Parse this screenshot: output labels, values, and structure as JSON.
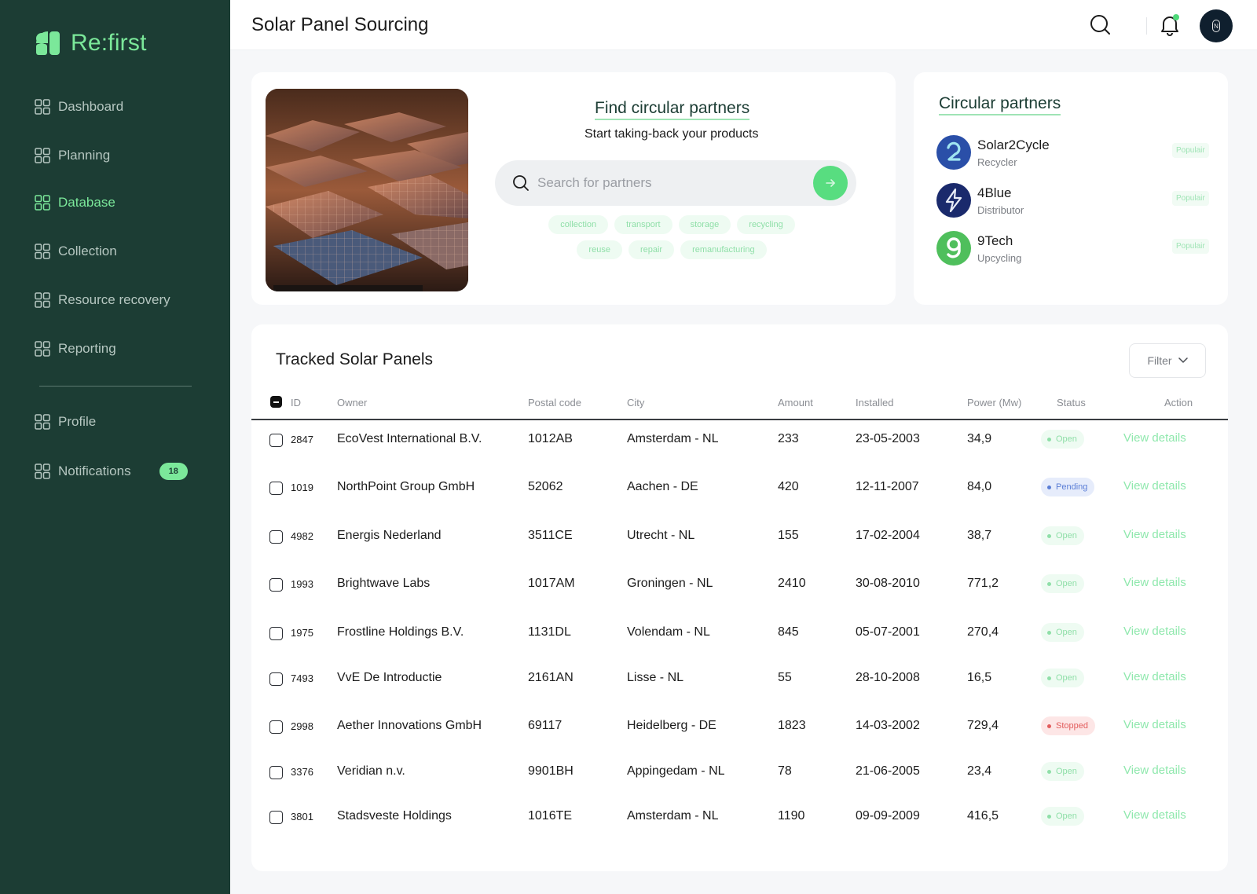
{
  "brand": {
    "name": "Re:first"
  },
  "sidebar": {
    "items": [
      {
        "label": "Dashboard",
        "active": false
      },
      {
        "label": "Planning",
        "active": false
      },
      {
        "label": "Database",
        "active": true
      },
      {
        "label": "Collection",
        "active": false
      },
      {
        "label": "Resource recovery",
        "active": false
      },
      {
        "label": "Reporting",
        "active": false
      }
    ],
    "bottom_items": [
      {
        "label": "Profile"
      },
      {
        "label": "Notifications",
        "badge": "18"
      }
    ]
  },
  "header": {
    "title": "Solar Panel Sourcing"
  },
  "find": {
    "title": "Find circular partners",
    "subtitle": "Start taking-back your products",
    "search_placeholder": "Search for partners",
    "chips_row1": [
      "collection",
      "transport",
      "storage",
      "recycling"
    ],
    "chips_row2": [
      "reuse",
      "repair",
      "remanufacturing"
    ]
  },
  "partners": {
    "title": "Circular partners",
    "items": [
      {
        "name": "Solar2Cycle",
        "role": "Recycler",
        "tag": "Populair",
        "icon": "cycle-2-icon",
        "color": "#2a4fa8"
      },
      {
        "name": "4Blue",
        "role": "Distributor",
        "tag": "Populair",
        "icon": "bolt-icon",
        "color": "#1a2a6c"
      },
      {
        "name": "9Tech",
        "role": "Upcycling",
        "tag": "Populair",
        "icon": "nine-icon",
        "color": "#4fbf5c"
      }
    ]
  },
  "table": {
    "title": "Tracked Solar Panels",
    "filter_label": "Filter",
    "columns": [
      "ID",
      "Owner",
      "Postal code",
      "City",
      "Amount",
      "Installed",
      "Power (Mw)",
      "Status",
      "Action"
    ],
    "action_label": "View details",
    "rows": [
      {
        "id": "2847",
        "owner": "EcoVest International B.V.",
        "postal": "1012AB",
        "city": "Amsterdam - NL",
        "amount": "233",
        "installed": "23-05-2003",
        "power": "34,9",
        "status": "Open"
      },
      {
        "id": "1019",
        "owner": "NorthPoint Group GmbH",
        "postal": "52062",
        "city": "Aachen - DE",
        "amount": "420",
        "installed": "12-11-2007",
        "power": "84,0",
        "status": "Pending"
      },
      {
        "id": "4982",
        "owner": "Energis Nederland",
        "postal": "3511CE",
        "city": "Utrecht - NL",
        "amount": "155",
        "installed": "17-02-2004",
        "power": "38,7",
        "status": "Open"
      },
      {
        "id": "1993",
        "owner": "Brightwave Labs",
        "postal": "1017AM",
        "city": "Groningen - NL",
        "amount": "2410",
        "installed": "30-08-2010",
        "power": "771,2",
        "status": "Open"
      },
      {
        "id": "1975",
        "owner": "Frostline Holdings B.V.",
        "postal": "1131DL",
        "city": "Volendam - NL",
        "amount": "845",
        "installed": "05-07-2001",
        "power": "270,4",
        "status": "Open"
      },
      {
        "id": "7493",
        "owner": "VvE De Introductie",
        "postal": "2161AN",
        "city": "Lisse - NL",
        "amount": "55",
        "installed": "28-10-2008",
        "power": "16,5",
        "status": "Open"
      },
      {
        "id": "2998",
        "owner": "Aether Innovations GmbH",
        "postal": "69117",
        "city": "Heidelberg - DE",
        "amount": "1823",
        "installed": "14-03-2002",
        "power": "729,4",
        "status": "Stopped"
      },
      {
        "id": "3376",
        "owner": "Veridian n.v.",
        "postal": "9901BH",
        "city": "Appingedam - NL",
        "amount": "78",
        "installed": "21-06-2005",
        "power": "23,4",
        "status": "Open"
      },
      {
        "id": "3801",
        "owner": "Stadsveste Holdings",
        "postal": "1016TE",
        "city": "Amsterdam - NL",
        "amount": "1190",
        "installed": "09-09-2009",
        "power": "416,5",
        "status": "Open"
      }
    ]
  },
  "colors": {
    "sidebar_bg": "#1c3d34",
    "accent": "#7be89a",
    "status_open_bg": "#eefbf2",
    "status_open_fg": "#8fdfa8",
    "status_pending_bg": "#e6ecfb",
    "status_pending_fg": "#5b7ed6",
    "status_stopped_bg": "#fde6e6",
    "status_stopped_fg": "#e25c5c"
  }
}
